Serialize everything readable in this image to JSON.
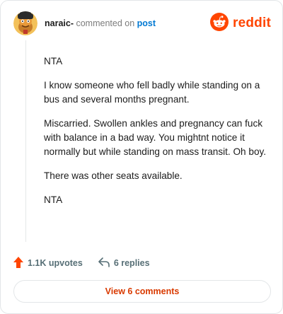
{
  "header": {
    "username": "naraic-",
    "context_text": "commented on",
    "post_link": "post",
    "brand_name": "reddit"
  },
  "comment": {
    "paragraphs": [
      "NTA",
      "I know someone who fell badly while standing on a bus and several months pregnant.",
      "Miscarried. Swollen ankles and pregnancy can fuck with balance in a bad way. You mightnt notice it normally but while standing on mass transit. Oh boy.",
      "There was other seats available.",
      "NTA"
    ]
  },
  "actions": {
    "upvotes": "1.1K upvotes",
    "replies": "6 replies"
  },
  "view_button": "View 6 comments",
  "colors": {
    "brand": "#ff4500",
    "link": "#0079d3",
    "view_button_text": "#d93a00",
    "muted": "#576f76"
  },
  "icons": [
    "reddit-logo-icon",
    "upvote-arrow-icon",
    "reply-arrow-icon"
  ]
}
